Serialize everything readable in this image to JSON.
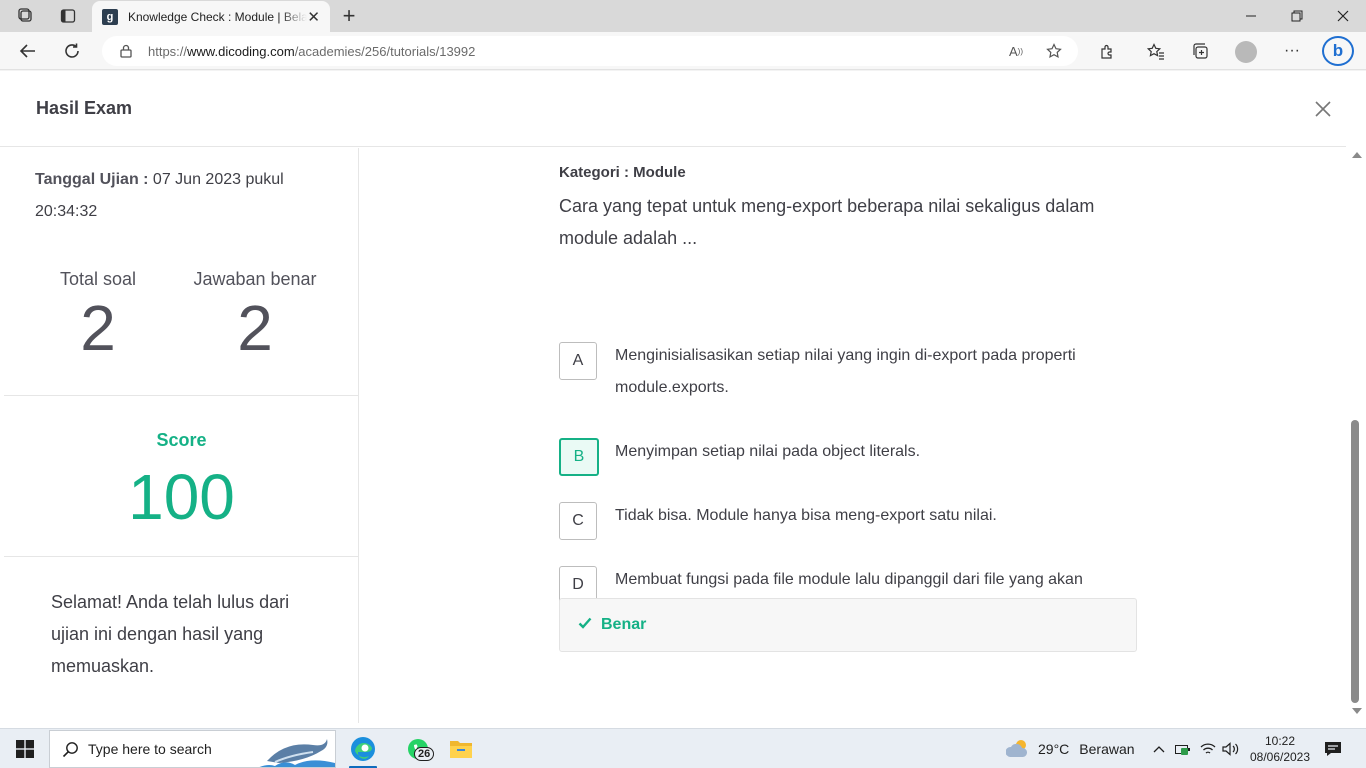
{
  "browser": {
    "tab_title": "Knowledge Check : Module | Belajar",
    "tab_favicon": "g",
    "url_protocol": "https://",
    "url_host": "www.dicoding.com",
    "url_path": "/academies/256/tutorials/13992"
  },
  "modal": {
    "title": "Hasil Exam"
  },
  "summary": {
    "date_label": "Tanggal Ujian :",
    "date_value": " 07 Jun 2023 pukul 20:34:32",
    "total_label": "Total soal",
    "total_value": "2",
    "correct_label": "Jawaban benar",
    "correct_value": "2",
    "score_label": "Score",
    "score_value": "100",
    "message": "Selamat! Anda telah lulus dari ujian ini dengan hasil yang memuaskan."
  },
  "question": {
    "category": "Kategori : Module",
    "text": "Cara yang tepat untuk meng-export beberapa nilai sekaligus dalam module adalah ...",
    "options": [
      {
        "letter": "A",
        "text": "Menginisialisasikan setiap nilai yang ingin di-export pada properti module.exports."
      },
      {
        "letter": "B",
        "text": "Menyimpan setiap nilai pada object literals."
      },
      {
        "letter": "C",
        "text": "Tidak bisa. Module hanya bisa meng-export satu nilai."
      },
      {
        "letter": "D",
        "text": "Membuat fungsi pada file module lalu dipanggil dari file yang akan menggunakannya."
      }
    ],
    "selected": "B",
    "result": "Benar"
  },
  "taskbar": {
    "search_placeholder": "Type here to search",
    "whatsapp_badge": "26",
    "weather_temp": "29°C",
    "weather_desc": "Berawan",
    "time": "10:22",
    "date": "08/06/2023"
  },
  "colors": {
    "accent": "#15b186",
    "text": "#3f3f46",
    "taskbar": "#e9eef4"
  }
}
